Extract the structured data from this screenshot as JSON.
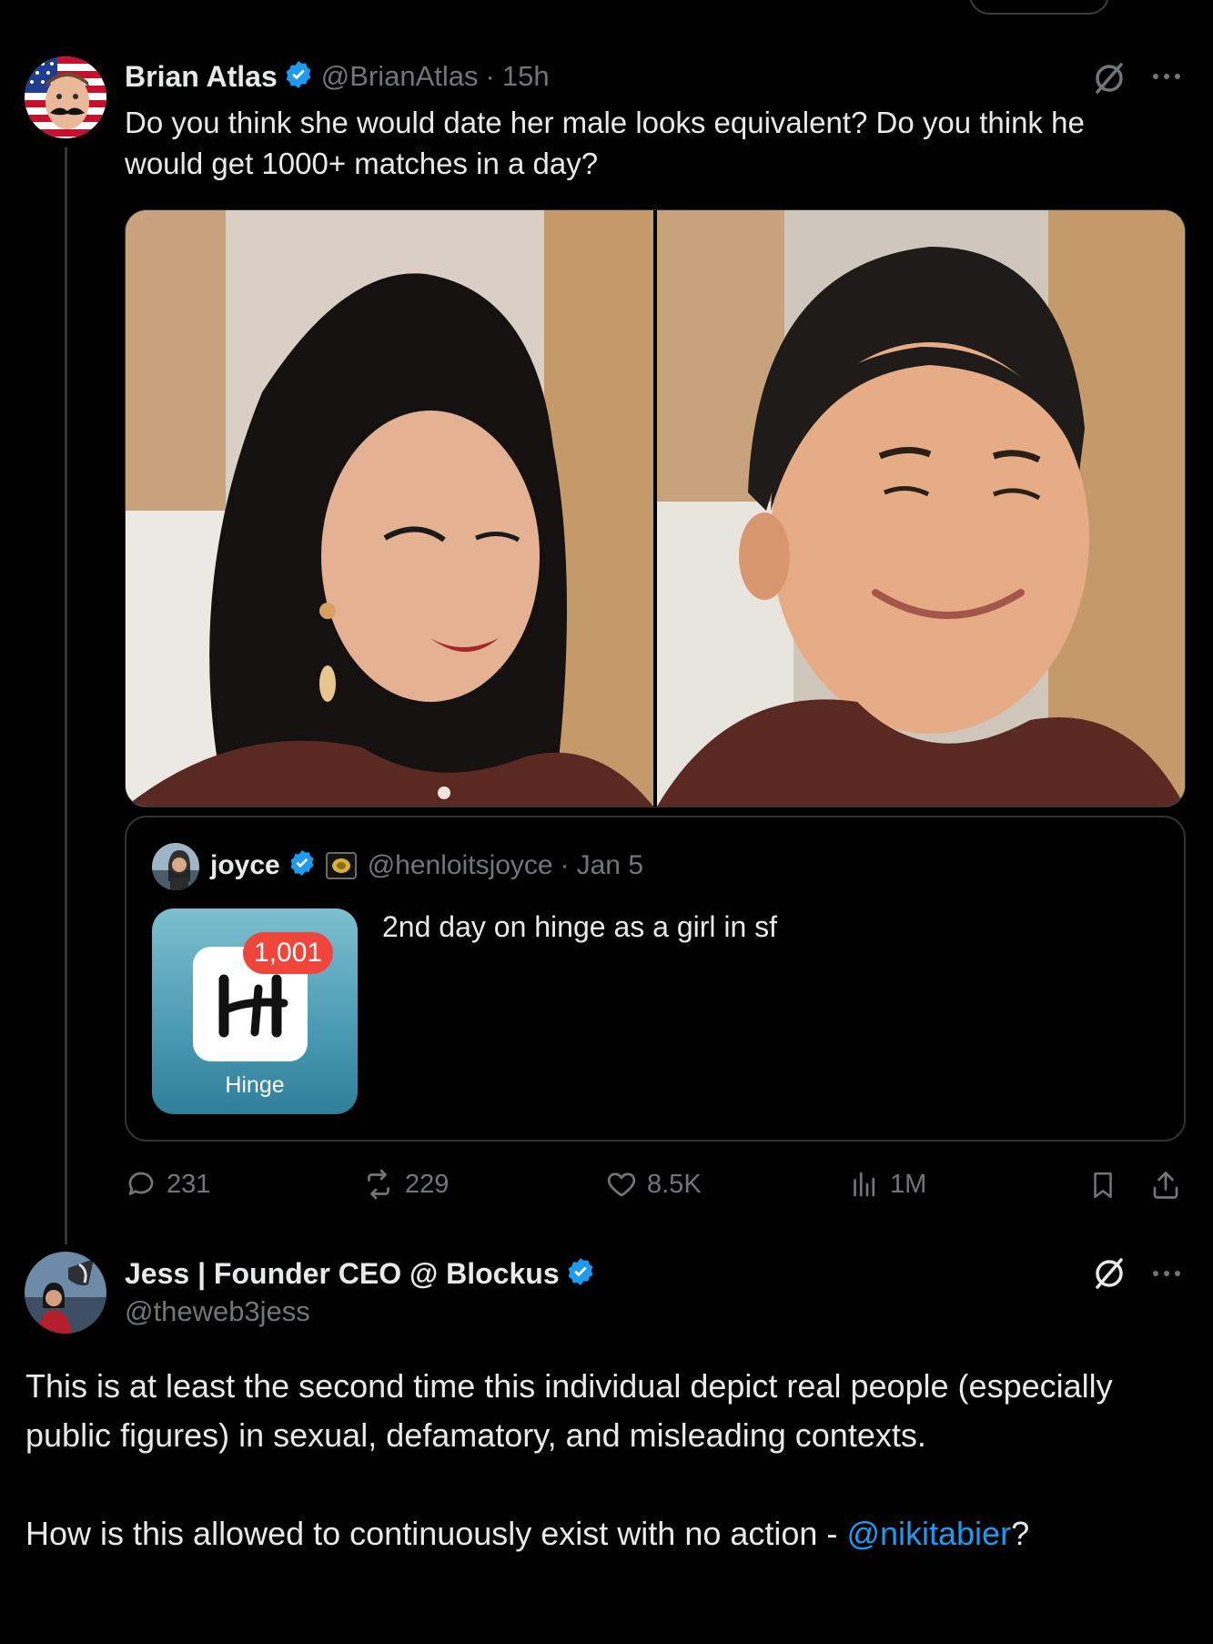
{
  "tweet": {
    "author_name": "Brian Atlas",
    "handle": "@BrianAtlas",
    "separator": "·",
    "time": "15h",
    "text": "Do you think she would date her male looks equivalent? Do you think he would get 1000+ matches in a day?",
    "icons": {
      "grok": "grok-slash-icon",
      "more": "more-dots-icon",
      "verified": "verified-badge-icon"
    },
    "media": [
      "woman-portrait-photo",
      "man-portrait-photo"
    ]
  },
  "quote": {
    "author_name": "joyce",
    "handle": "@henloitsjoyce",
    "separator": "·",
    "date": "Jan 5",
    "text": "2nd day on hinge as a girl in sf",
    "thumbnail": {
      "app_name": "Hinge",
      "notification_count": "1,001",
      "badge_color": "#f0453a"
    }
  },
  "actions": {
    "replies": "231",
    "reposts": "229",
    "likes": "8.5K",
    "views": "1M"
  },
  "reply": {
    "author_name": "Jess | Founder CEO @ Blockus",
    "handle": "@theweb3jess",
    "paragraph1": "This is at least the second time this individual depict real people (especially public figures) in sexual, defamatory, and misleading contexts.",
    "paragraph2_prefix": "How is this allowed to continuously exist with no action - ",
    "mention": "@nikitabier",
    "paragraph2_suffix": "?"
  },
  "colors": {
    "background": "#000000",
    "text": "#e7e9ea",
    "secondary": "#71767b",
    "accent": "#1d9bf0",
    "border": "#2f3336"
  }
}
